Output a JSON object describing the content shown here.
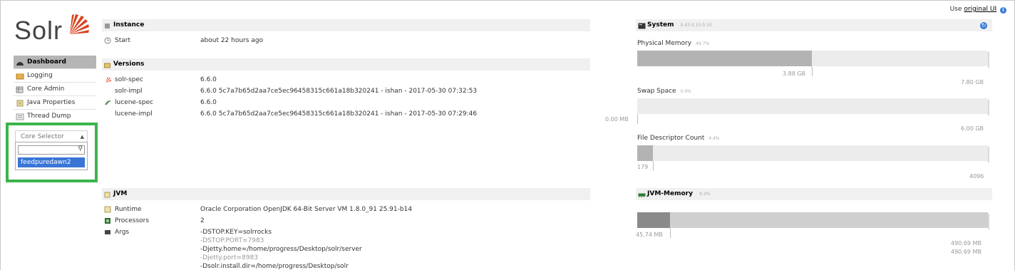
{
  "header": {
    "use_prefix": "Use",
    "original_ui_link": "original UI",
    "info_icon": "info-icon"
  },
  "logo": {
    "text": "Solr",
    "icon": "solr-sunburst-logo"
  },
  "sidebar": {
    "items": [
      {
        "label": "Dashboard",
        "icon": "dashboard-icon",
        "active": true
      },
      {
        "label": "Logging",
        "icon": "logging-icon",
        "active": false
      },
      {
        "label": "Core Admin",
        "icon": "core-admin-icon",
        "active": false
      },
      {
        "label": "Java Properties",
        "icon": "java-properties-icon",
        "active": false
      },
      {
        "label": "Thread Dump",
        "icon": "thread-dump-icon",
        "active": false
      }
    ],
    "core_selector": {
      "placeholder": "Core Selector",
      "search_value": "",
      "options": [
        "feedpuredawn2"
      ]
    }
  },
  "instance": {
    "title": "Instance",
    "start_label": "Start",
    "start_value": "about 22 hours ago"
  },
  "versions": {
    "title": "Versions",
    "rows": [
      {
        "label": "solr-spec",
        "value": "6.6.0"
      },
      {
        "label": "solr-impl",
        "value": "6.6.0 5c7a7b65d2aa7ce5ec96458315c661a18b320241 - ishan - 2017-05-30 07:32:53"
      },
      {
        "label": "lucene-spec",
        "value": "6.6.0"
      },
      {
        "label": "lucene-impl",
        "value": "6.6.0 5c7a7b65d2aa7ce5ec96458315c661a18b320241 - ishan - 2017-05-30 07:29:46"
      }
    ]
  },
  "jvm": {
    "title": "JVM",
    "runtime_label": "Runtime",
    "runtime_value": "Oracle Corporation OpenJDK 64-Bit Server VM 1.8.0_91 25.91-b14",
    "processors_label": "Processors",
    "processors_value": "2",
    "args_label": "Args",
    "args": [
      {
        "text": "-DSTOP.KEY=solrrocks",
        "dim": false
      },
      {
        "text": "-DSTOP.PORT=7983",
        "dim": true
      },
      {
        "text": "-Djetty.home=/home/progress/Desktop/solr/server",
        "dim": false
      },
      {
        "text": "-Djetty.port=8983",
        "dim": true
      },
      {
        "text": "-Dsolr.install.dir=/home/progress/Desktop/solr",
        "dim": false
      }
    ]
  },
  "system": {
    "title": "System",
    "load": "0.43 0.15 0.10",
    "physical_memory": {
      "label": "Physical Memory",
      "pct": "49.7%",
      "used": "3.88 GB",
      "total": "7.80 GB",
      "fraction": 0.497
    },
    "swap_space": {
      "label": "Swap Space",
      "pct": "0.0%",
      "used": "0.00 MB",
      "total": "6.00 GB",
      "fraction": 0.0
    },
    "file_descriptor": {
      "label": "File Descriptor Count",
      "pct": "4.4%",
      "used": "179",
      "total": "4096",
      "fraction": 0.044
    }
  },
  "jvm_memory": {
    "title": "JVM-Memory",
    "pct": "9.3%",
    "used": "45.74 MB",
    "committed": "490.69 MB",
    "max": "490.69 MB",
    "used_fraction": 0.093
  }
}
